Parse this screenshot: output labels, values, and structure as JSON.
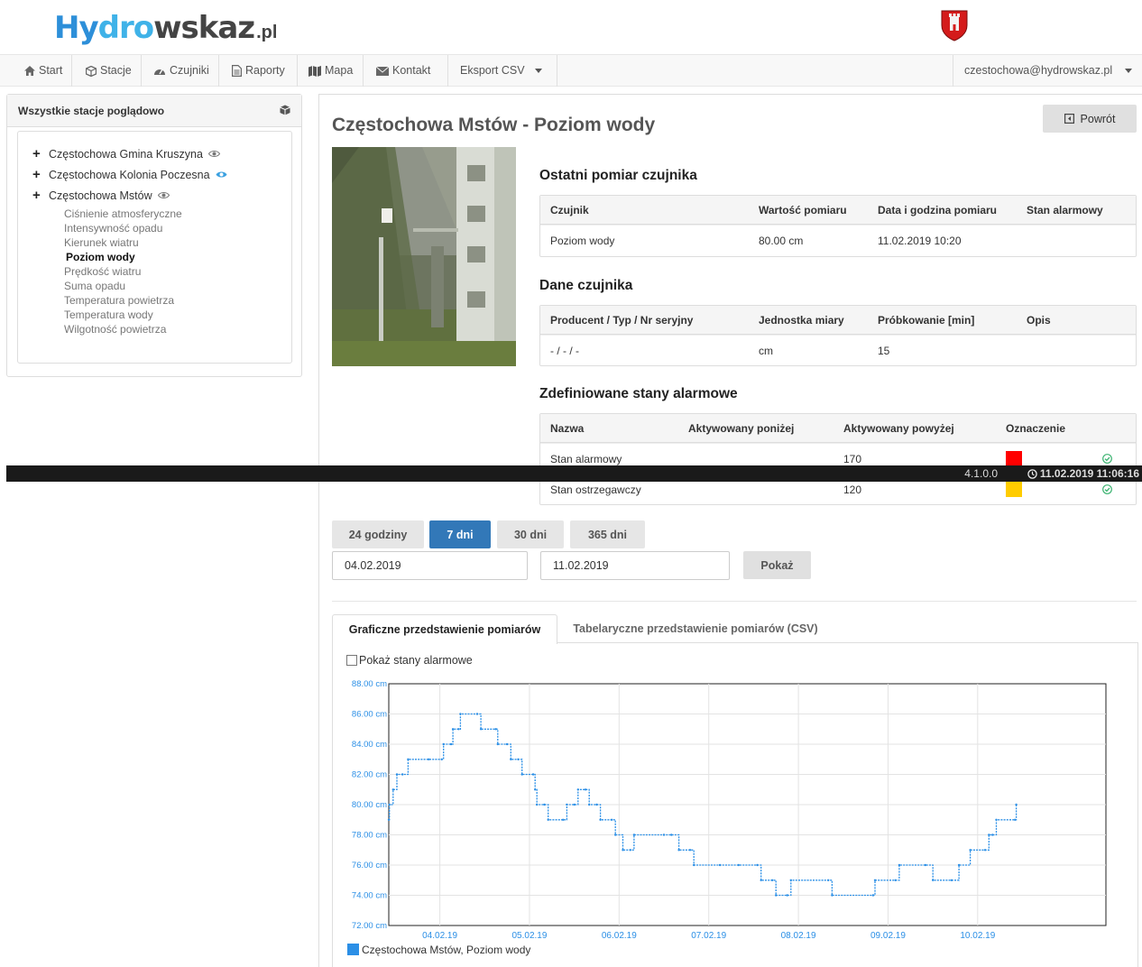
{
  "brand": {
    "logo_a": "Hy",
    "logo_b": "dro",
    "logo_c": "wskaz",
    "logo_tld": ".pl"
  },
  "nav": {
    "items": [
      {
        "label": "Start",
        "icon": "home-icon"
      },
      {
        "label": "Stacje",
        "icon": "cube-icon"
      },
      {
        "label": "Czujniki",
        "icon": "tachometer-icon"
      },
      {
        "label": "Raporty",
        "icon": "file-icon"
      },
      {
        "label": "Mapa",
        "icon": "map-icon"
      },
      {
        "label": "Kontakt",
        "icon": "envelope-icon"
      },
      {
        "label": "Eksport CSV",
        "icon": "caret-down-icon"
      }
    ],
    "user": "czestochowa@hydrowskaz.pl"
  },
  "sidebar": {
    "title": "Wszystkie stacje poglądowo",
    "stations": [
      {
        "name": "Częstochowa Gmina Kruszyna"
      },
      {
        "name": "Częstochowa Kolonia Poczesna"
      },
      {
        "name": "Częstochowa Mstów"
      }
    ],
    "sensors": [
      "Ciśnienie atmosferyczne",
      "Intensywność opadu",
      "Kierunek wiatru",
      "Poziom wody",
      "Prędkość wiatru",
      "Suma opadu",
      "Temperatura powietrza",
      "Temperatura wody",
      "Wilgotność powietrza"
    ],
    "active_sensor": "Poziom wody"
  },
  "main": {
    "title": "Częstochowa Mstów - Poziom wody",
    "back_label": "Powrót",
    "last_measurement": {
      "title": "Ostatni pomiar czujnika",
      "headers": [
        "Czujnik",
        "Wartość pomiaru",
        "Data i godzina pomiaru",
        "Stan alarmowy"
      ],
      "row": [
        "Poziom wody",
        "80.00 cm",
        "11.02.2019 10:20",
        ""
      ]
    },
    "sensor_data": {
      "title": "Dane czujnika",
      "headers": [
        "Producent / Typ / Nr seryjny",
        "Jednostka miary",
        "Próbkowanie [min]",
        "Opis"
      ],
      "row": [
        "- / - / -",
        "cm",
        "15",
        ""
      ]
    },
    "alarms": {
      "title": "Zdefiniowane stany alarmowe",
      "headers": [
        "Nazwa",
        "Aktywowany poniżej",
        "Aktywowany powyżej",
        "Oznaczenie"
      ],
      "rows": [
        {
          "name": "Stan alarmowy",
          "below": "",
          "above": "170",
          "color": "#ff0000"
        },
        {
          "name": "Stan ostrzegawczy",
          "below": "",
          "above": "120",
          "color": "#ffcc00"
        }
      ]
    },
    "ranges": [
      "24 godziny",
      "7 dni",
      "30 dni",
      "365 dni"
    ],
    "active_range": "7 dni",
    "date_from": "04.02.2019",
    "date_to": "11.02.2019",
    "show_label": "Pokaż",
    "tabs": [
      "Graficzne przedstawienie pomiarów",
      "Tabelaryczne przedstawienie pomiarów (CSV)"
    ],
    "checkbox_label": "Pokaż stany alarmowe"
  },
  "statusbar": {
    "version": "4.1.0.0",
    "datetime": "11.02.2019 11:06:16"
  },
  "chart_data": {
    "type": "line",
    "ylim": [
      72,
      88
    ],
    "yticks": [
      "72.00 cm",
      "74.00 cm",
      "76.00 cm",
      "78.00 cm",
      "80.00 cm",
      "82.00 cm",
      "84.00 cm",
      "86.00 cm",
      "88.00 cm"
    ],
    "xticks": [
      "04.02.19",
      "05.02.19",
      "06.02.19",
      "07.02.19",
      "08.02.19",
      "09.02.19",
      "10.02.19"
    ],
    "x_start": "03.02.2019 10:20",
    "x_end": "11.02.2019 10:20",
    "legend": "Częstochowa Mstów, Poziom wody",
    "series_color": "#2b8fe6",
    "series": [
      {
        "name": "Częstochowa Mstów, Poziom wody",
        "points": [
          [
            "03.02 10:20",
            79
          ],
          [
            "03.02 10:30",
            80
          ],
          [
            "03.02 11:30",
            81
          ],
          [
            "03.02 12:30",
            82
          ],
          [
            "03.02 14:00",
            82
          ],
          [
            "03.02 15:30",
            83
          ],
          [
            "03.02 21:00",
            83
          ],
          [
            "04.02 00:30",
            83
          ],
          [
            "04.02 01:00",
            84
          ],
          [
            "04.02 03:00",
            84
          ],
          [
            "04.02 03:30",
            85
          ],
          [
            "04.02 05:00",
            85
          ],
          [
            "04.02 05:30",
            86
          ],
          [
            "04.02 10:00",
            86
          ],
          [
            "04.02 11:00",
            85
          ],
          [
            "04.02 15:00",
            85
          ],
          [
            "04.02 15:30",
            84
          ],
          [
            "04.02 18:00",
            84
          ],
          [
            "04.02 19:00",
            83
          ],
          [
            "04.02 21:00",
            83
          ],
          [
            "04.02 22:00",
            82
          ],
          [
            "05.02 01:00",
            82
          ],
          [
            "05.02 01:30",
            81
          ],
          [
            "05.02 02:00",
            80
          ],
          [
            "05.02 04:00",
            80
          ],
          [
            "05.02 05:00",
            79
          ],
          [
            "05.02 09:00",
            79
          ],
          [
            "05.02 10:00",
            80
          ],
          [
            "05.02 12:00",
            80
          ],
          [
            "05.02 13:00",
            81
          ],
          [
            "05.02 15:00",
            81
          ],
          [
            "05.02 16:00",
            80
          ],
          [
            "05.02 18:00",
            80
          ],
          [
            "05.02 19:00",
            79
          ],
          [
            "05.02 22:00",
            79
          ],
          [
            "05.02 23:00",
            78
          ],
          [
            "06.02 01:00",
            77
          ],
          [
            "06.02 03:00",
            77
          ],
          [
            "06.02 04:00",
            78
          ],
          [
            "06.02 12:00",
            78
          ],
          [
            "06.02 14:00",
            78
          ],
          [
            "06.02 16:00",
            77
          ],
          [
            "06.02 19:00",
            77
          ],
          [
            "06.02 20:00",
            76
          ],
          [
            "07.02 03:00",
            76
          ],
          [
            "07.02 08:00",
            76
          ],
          [
            "07.02 13:00",
            76
          ],
          [
            "07.02 14:00",
            75
          ],
          [
            "07.02 17:00",
            75
          ],
          [
            "07.02 18:00",
            74
          ],
          [
            "07.02 21:00",
            74
          ],
          [
            "07.02 22:00",
            75
          ],
          [
            "08.02 08:00",
            75
          ],
          [
            "08.02 09:00",
            74
          ],
          [
            "08.02 20:00",
            74
          ],
          [
            "08.02 20:30",
            75
          ],
          [
            "09.02 02:00",
            75
          ],
          [
            "09.02 03:00",
            76
          ],
          [
            "09.02 10:00",
            76
          ],
          [
            "09.02 12:00",
            75
          ],
          [
            "09.02 17:00",
            75
          ],
          [
            "09.02 19:00",
            76
          ],
          [
            "09.02 22:00",
            77
          ],
          [
            "10.02 02:00",
            77
          ],
          [
            "10.02 03:00",
            78
          ],
          [
            "10.02 04:00",
            78
          ],
          [
            "10.02 05:00",
            79
          ],
          [
            "10.02 10:00",
            79
          ],
          [
            "10.02 10:20",
            80
          ]
        ]
      }
    ]
  }
}
